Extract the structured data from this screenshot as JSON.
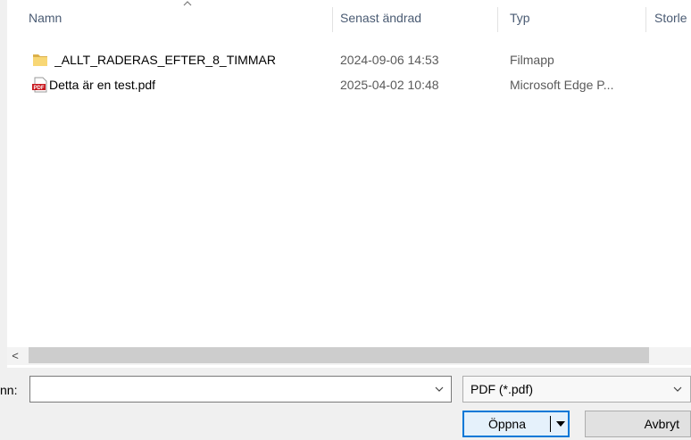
{
  "columns": {
    "name": "Namn",
    "modified": "Senast ändrad",
    "type": "Typ",
    "size": "Storle"
  },
  "files": [
    {
      "name": "_ALLT_RADERAS_EFTER_8_TIMMAR",
      "modified": "2024-09-06 14:53",
      "type": "Filmapp",
      "icon": "folder-icon"
    },
    {
      "name": "Detta är en test.pdf",
      "modified": "2025-04-02 10:48",
      "type": "Microsoft Edge P...",
      "icon": "pdf-icon"
    }
  ],
  "scrollbar": {
    "left_arrow": "<"
  },
  "filename": {
    "label": "nn:",
    "value": ""
  },
  "filetype": {
    "selected": "PDF (*.pdf)"
  },
  "buttons": {
    "open": "Öppna",
    "cancel": "Avbryt"
  },
  "colors": {
    "accent": "#0078d7",
    "folder": "#f8d775",
    "pdf": "#c8161d"
  }
}
